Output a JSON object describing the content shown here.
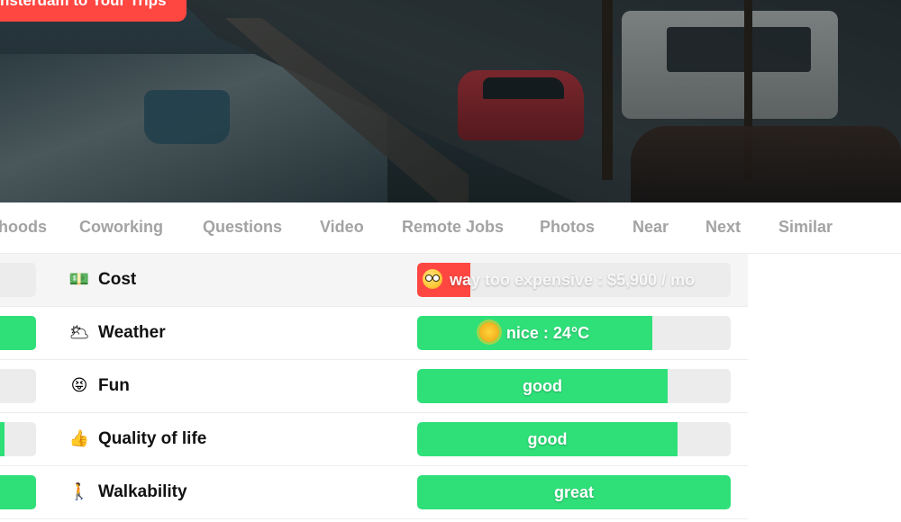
{
  "header": {
    "trips_button_label": "nsterdam to Your Trips"
  },
  "tabs": [
    {
      "label": "hoods"
    },
    {
      "label": "Coworking"
    },
    {
      "label": "Questions"
    },
    {
      "label": "Video"
    },
    {
      "label": "Remote Jobs"
    },
    {
      "label": "Photos"
    },
    {
      "label": "Near"
    },
    {
      "label": "Next"
    },
    {
      "label": "Similar"
    }
  ],
  "rows": [
    {
      "icon": "money-icon",
      "label": "Cost",
      "value_text": "way too expensive : $5,900 / mo",
      "score": 0.17,
      "color": "#ff4742",
      "emoji": "flushed-face-icon",
      "left_stub_score": 0.0
    },
    {
      "icon": "cloud-sun-icon",
      "label": "Weather",
      "value_text": "nice : 24°C",
      "score": 0.75,
      "color": "#2fe079",
      "emoji": "sun-icon",
      "left_stub_score": 1.0
    },
    {
      "icon": "tongue-face-icon",
      "label": "Fun",
      "value_text": "good",
      "score": 0.8,
      "color": "#2fe079",
      "left_stub_score": 0.0
    },
    {
      "icon": "thumbs-up-icon",
      "label": "Quality of life",
      "value_text": "good",
      "score": 0.83,
      "color": "#2fe079",
      "left_stub_score": 0.3
    },
    {
      "icon": "walking-person-icon",
      "label": "Walkability",
      "value_text": "great",
      "score": 1.0,
      "color": "#2fe079",
      "left_stub_score": 1.0
    }
  ],
  "colors": {
    "accent_red": "#ff4742",
    "accent_green": "#2fe079",
    "bar_track": "#ececec",
    "tab_text": "#a3a3a3"
  }
}
